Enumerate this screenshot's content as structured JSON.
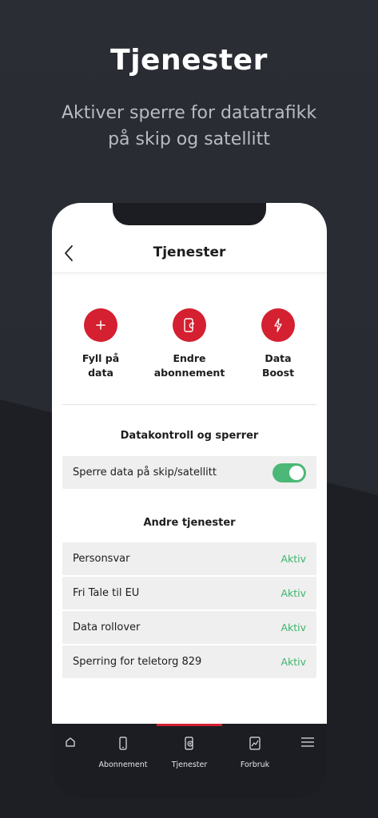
{
  "hero": {
    "title": "Tjenester",
    "subtitle_line1": "Aktiver sperre for datatrafikk",
    "subtitle_line2": "på skip og satellitt"
  },
  "app": {
    "title": "Tjenester",
    "back_icon": "chevron-left-icon"
  },
  "quick_actions": [
    {
      "line1": "Fyll på",
      "line2": "data",
      "icon": "plus-icon"
    },
    {
      "line1": "Endre",
      "line2": "abonnement",
      "icon": "phone-change-icon"
    },
    {
      "line1": "Data",
      "line2": "Boost",
      "icon": "lightning-icon"
    }
  ],
  "data_control": {
    "title": "Datakontroll og sperrer",
    "items": [
      {
        "label": "Sperre data på skip/satellitt",
        "enabled": true
      }
    ]
  },
  "other_services": {
    "title": "Andre tjenester",
    "items": [
      {
        "label": "Personsvar",
        "status": "Aktiv"
      },
      {
        "label": "Fri Tale til EU",
        "status": "Aktiv"
      },
      {
        "label": "Data rollover",
        "status": "Aktiv"
      },
      {
        "label": "Sperring for teletorg 829",
        "status": "Aktiv"
      }
    ]
  },
  "tabbar": {
    "active": 2,
    "tabs": [
      {
        "label": "",
        "icon": "home-icon"
      },
      {
        "label": "Abonnement",
        "icon": "phone-icon"
      },
      {
        "label": "Tjenester",
        "icon": "services-icon"
      },
      {
        "label": "Forbruk",
        "icon": "usage-chart-icon"
      },
      {
        "label": "",
        "icon": "menu-icon"
      }
    ]
  },
  "colors": {
    "accent_red": "#d42030",
    "toggle_green": "#4cb877",
    "status_green": "#3db46d",
    "background_dark": "#2a2c33"
  }
}
